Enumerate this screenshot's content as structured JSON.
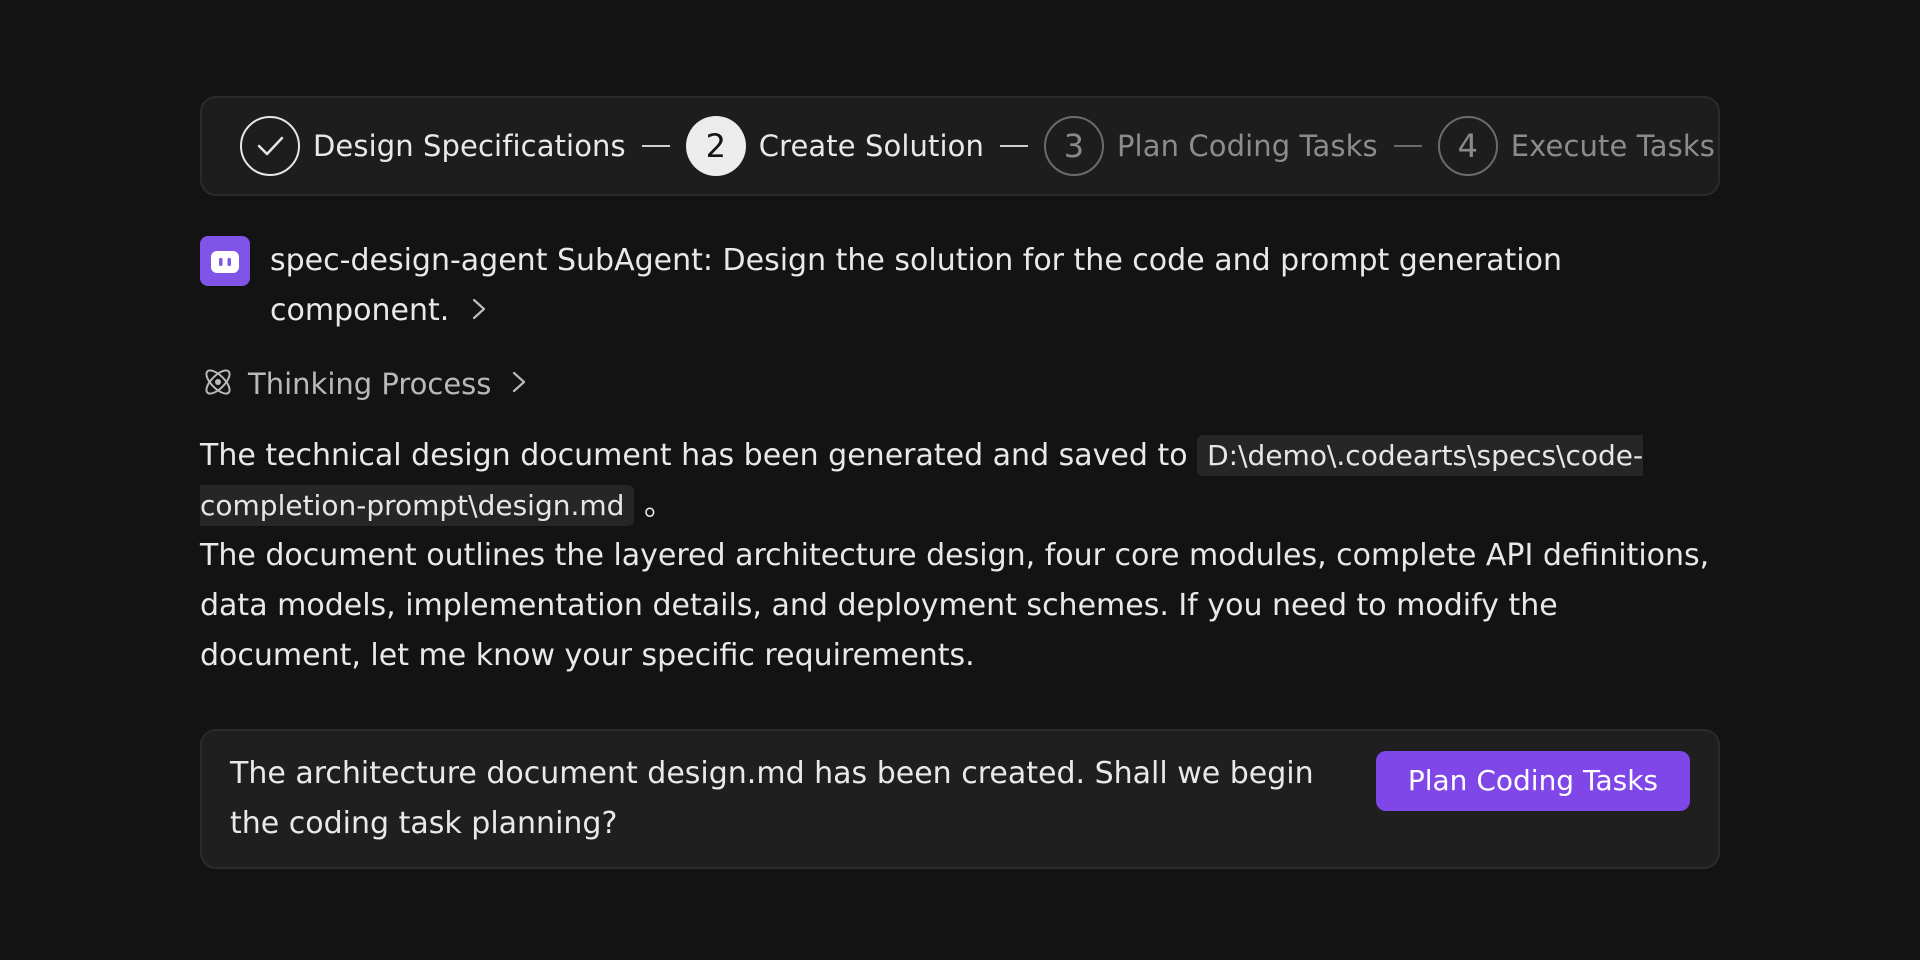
{
  "stepper": {
    "steps": [
      {
        "label": "Design Specifications",
        "state": "done",
        "number": ""
      },
      {
        "label": "Create Solution",
        "state": "current",
        "number": "2"
      },
      {
        "label": "Plan Coding Tasks",
        "state": "todo",
        "number": "3"
      },
      {
        "label": "Execute Tasks",
        "state": "todo",
        "number": "4"
      }
    ]
  },
  "subagent": {
    "text": "spec-design-agent SubAgent: Design the solution for the code and prompt generation component.",
    "icon": "robot-icon"
  },
  "thinking": {
    "label": "Thinking Process",
    "icon": "atom-icon"
  },
  "message": {
    "intro": "The technical design document has been generated and saved to",
    "path": "D:\\demo\\.codearts\\specs\\code-completion-prompt\\design.md",
    "end_mark": "。",
    "details": "The document outlines the layered architecture design, four core modules, complete API definitions, data models, implementation details, and deployment schemes. If you need to modify the document, let me know your specific requirements."
  },
  "prompt_card": {
    "text": "The architecture document design.md has been created. Shall we begin the coding task planning?",
    "button_label": "Plan Coding Tasks"
  },
  "colors": {
    "accent": "#8047e8",
    "background": "#131313",
    "panel": "#1d1d1d"
  }
}
